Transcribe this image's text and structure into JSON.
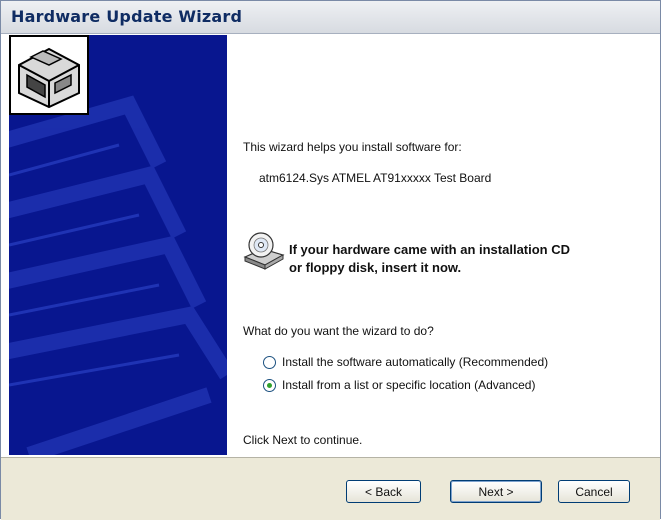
{
  "window": {
    "title": "Hardware Update Wizard"
  },
  "content": {
    "intro": "This wizard helps you install software for:",
    "device_name": "atm6124.Sys ATMEL AT91xxxxx Test Board",
    "cd_prompt_line1": "If your hardware came with an installation CD",
    "cd_prompt_line2": "or floppy disk, insert it now.",
    "question": "What do you want the wizard to do?",
    "options": [
      {
        "label": "Install the software automatically (Recommended)",
        "selected": false
      },
      {
        "label": "Install from a list or specific location (Advanced)",
        "selected": true
      }
    ],
    "footer_hint": "Click Next to continue."
  },
  "buttons": {
    "back": "< Back",
    "next": "Next >",
    "cancel": "Cancel"
  },
  "colors": {
    "side_panel": "#08168f",
    "title_text": "#0f2c63",
    "radio_selected": "#2fa02c"
  },
  "icons": {
    "wizard": "hardware-wizard-icon",
    "cd": "cd-drive-icon"
  }
}
